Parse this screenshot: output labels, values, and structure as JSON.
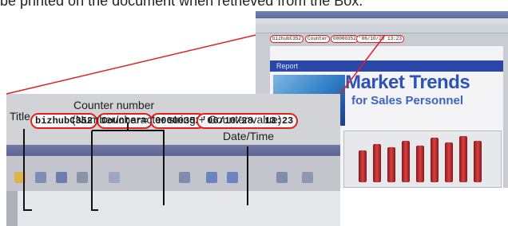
{
  "caption_top": "be printed on the document when retrieved from the Box.",
  "labels": {
    "title": "Title",
    "counter_number": "Counter number",
    "counter_detail": "(Number/character string + Counter value)",
    "date_time": "Date/Time"
  },
  "stamps": {
    "title": "bizhubC352",
    "counter_label": "Counter=",
    "counter_value": "00000352",
    "date_time": "'06/10/28  13:23"
  },
  "thumbnail": {
    "stamps": [
      "bizhubC352",
      "Counter",
      "00000352",
      "'06/10/28  13:23"
    ],
    "banner": "Report",
    "headline": "Market Trends",
    "subheadline": "for Sales Personnel"
  },
  "colors": {
    "callout_red": "#e02020",
    "title_bar": "#5c6593"
  }
}
